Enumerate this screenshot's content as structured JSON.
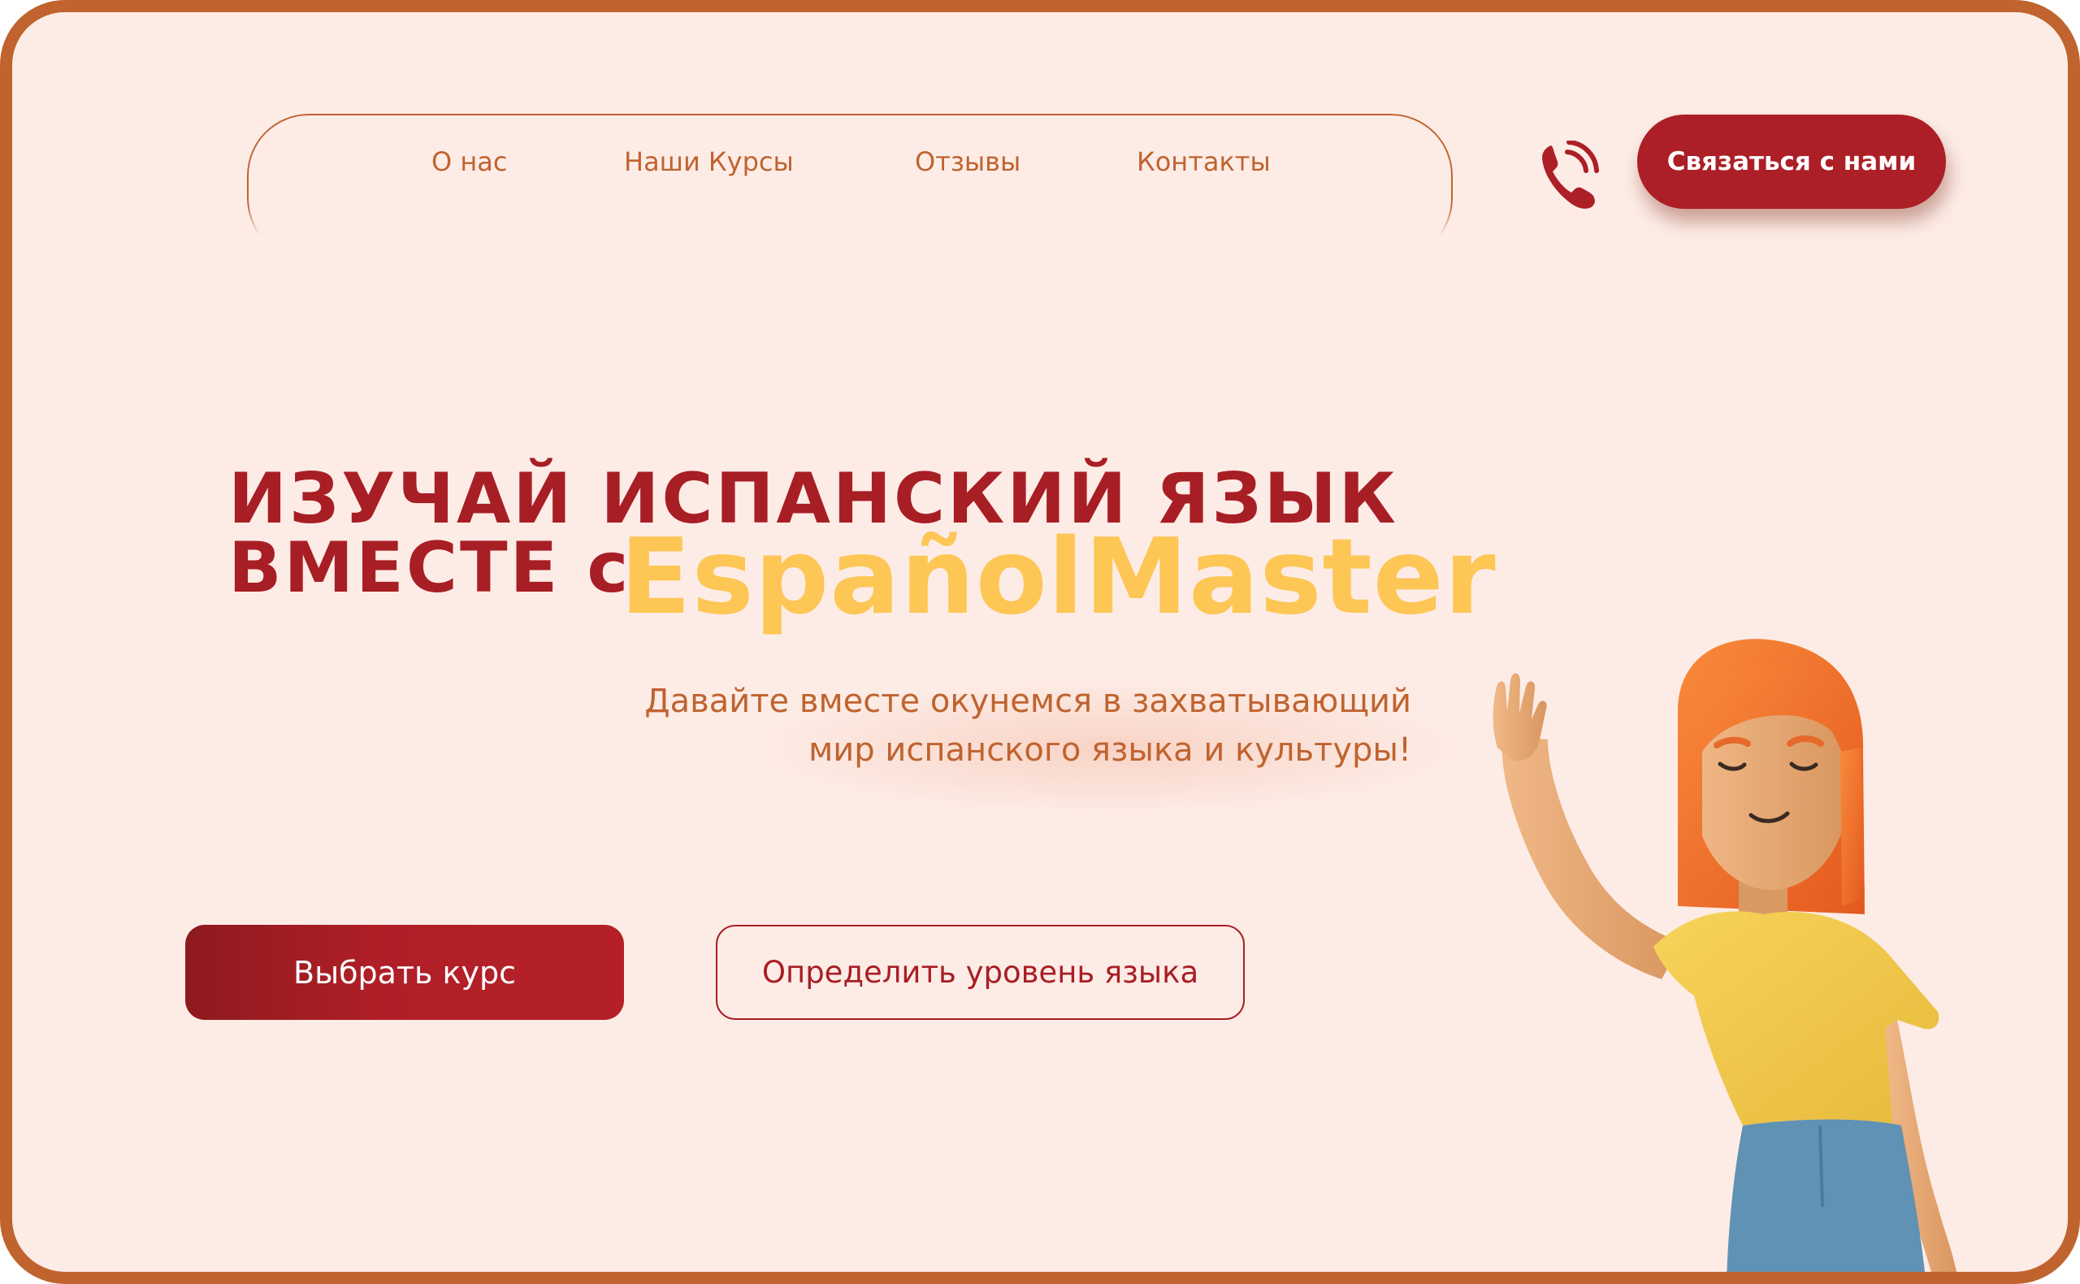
{
  "nav": {
    "items": [
      "О нас",
      "Наши Курсы",
      "Отзывы",
      "Контакты"
    ]
  },
  "header": {
    "phone_icon": "phone-icon",
    "contact_label": "Связаться с нами"
  },
  "hero": {
    "headline_line1": "ИЗУЧАЙ ИСПАНСКИЙ ЯЗЫК",
    "headline_line2": "ВМЕСТЕ с",
    "brand": "EspañolMaster",
    "subtitle_line1": "Давайте вместе окунемся в захватывающий",
    "subtitle_line2": "мир испанского языка и культуры!",
    "primary_button": "Выбрать курс",
    "secondary_button": "Определить уровень языка",
    "illustration": "waving-girl-illustration"
  },
  "colors": {
    "background": "#fdece6",
    "frame": "#c0632f",
    "accent_red": "#ac1f26",
    "brand_yellow": "#fdc655",
    "text_orange": "#c0632f"
  }
}
